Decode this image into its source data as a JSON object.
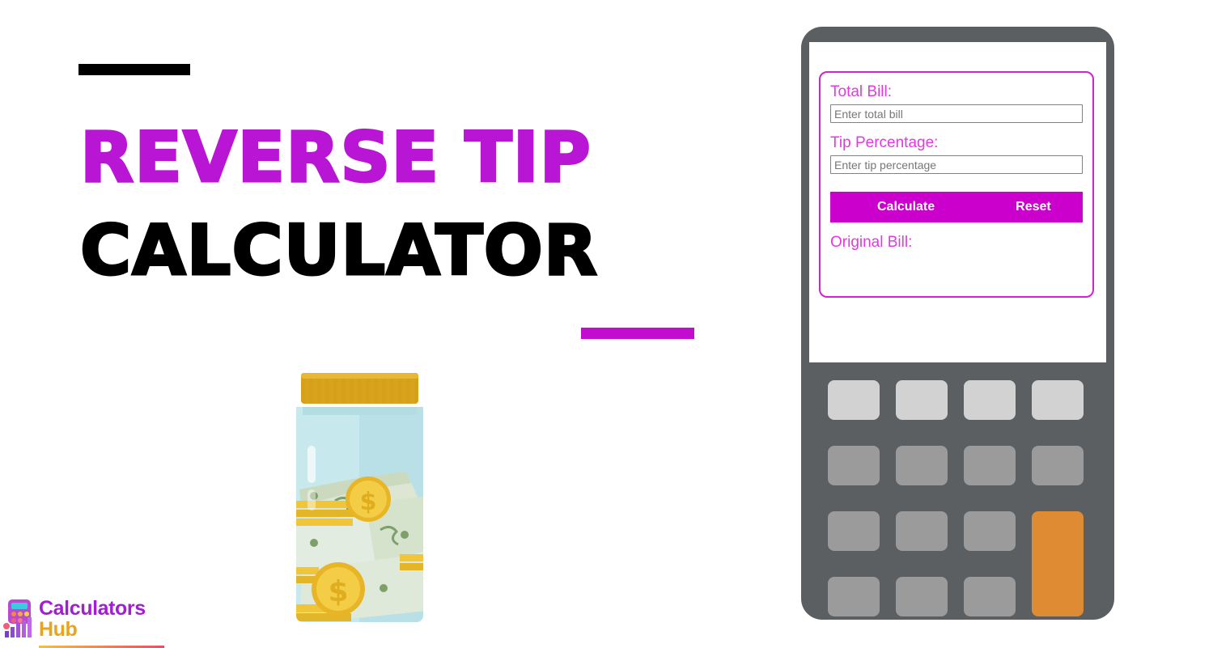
{
  "page": {
    "background_color": "#ffffff"
  },
  "hero": {
    "rule_top_color": "#000000",
    "rule_bottom_color": "#c20dd1",
    "title_line_1": "REVERSE TIP",
    "title_line_2": "CALCULATOR",
    "title_line_1_color": "#b816d4",
    "title_line_2_color": "#000000"
  },
  "illustration": {
    "name": "tip-jar-with-money",
    "jar_glass_color": "#c7e8ec",
    "jar_lid_color": "#d9a41b",
    "bill_color": "#dce6d2",
    "coin_color": "#f5c63c"
  },
  "logo": {
    "word_1": "Calculators",
    "word_2": "Hub",
    "word_1_color": "#a01fd0",
    "word_2_color": "#e8a41e",
    "mark": "calculator-bars-icon"
  },
  "calculator": {
    "body_color": "#5c5f61",
    "screen_color": "#ffffff",
    "accent_color": "#cc00cc",
    "label_color": "#e03ae0",
    "form": {
      "border_color": "#d41fd4",
      "fields": [
        {
          "name": "total-bill",
          "label": "Total Bill:",
          "placeholder": "Enter total bill",
          "value": ""
        },
        {
          "name": "tip-percentage",
          "label": "Tip Percentage:",
          "placeholder": "Enter tip percentage",
          "value": ""
        }
      ],
      "calculate_label": "Calculate",
      "reset_label": "Reset",
      "result_label": "Original Bill:",
      "result_value": ""
    },
    "keypad": {
      "rows": 4,
      "columns": 4,
      "key_light_color": "#d2d2d2",
      "key_gray_color": "#9b9b9b",
      "key_accent_color": "#de8b33"
    }
  }
}
